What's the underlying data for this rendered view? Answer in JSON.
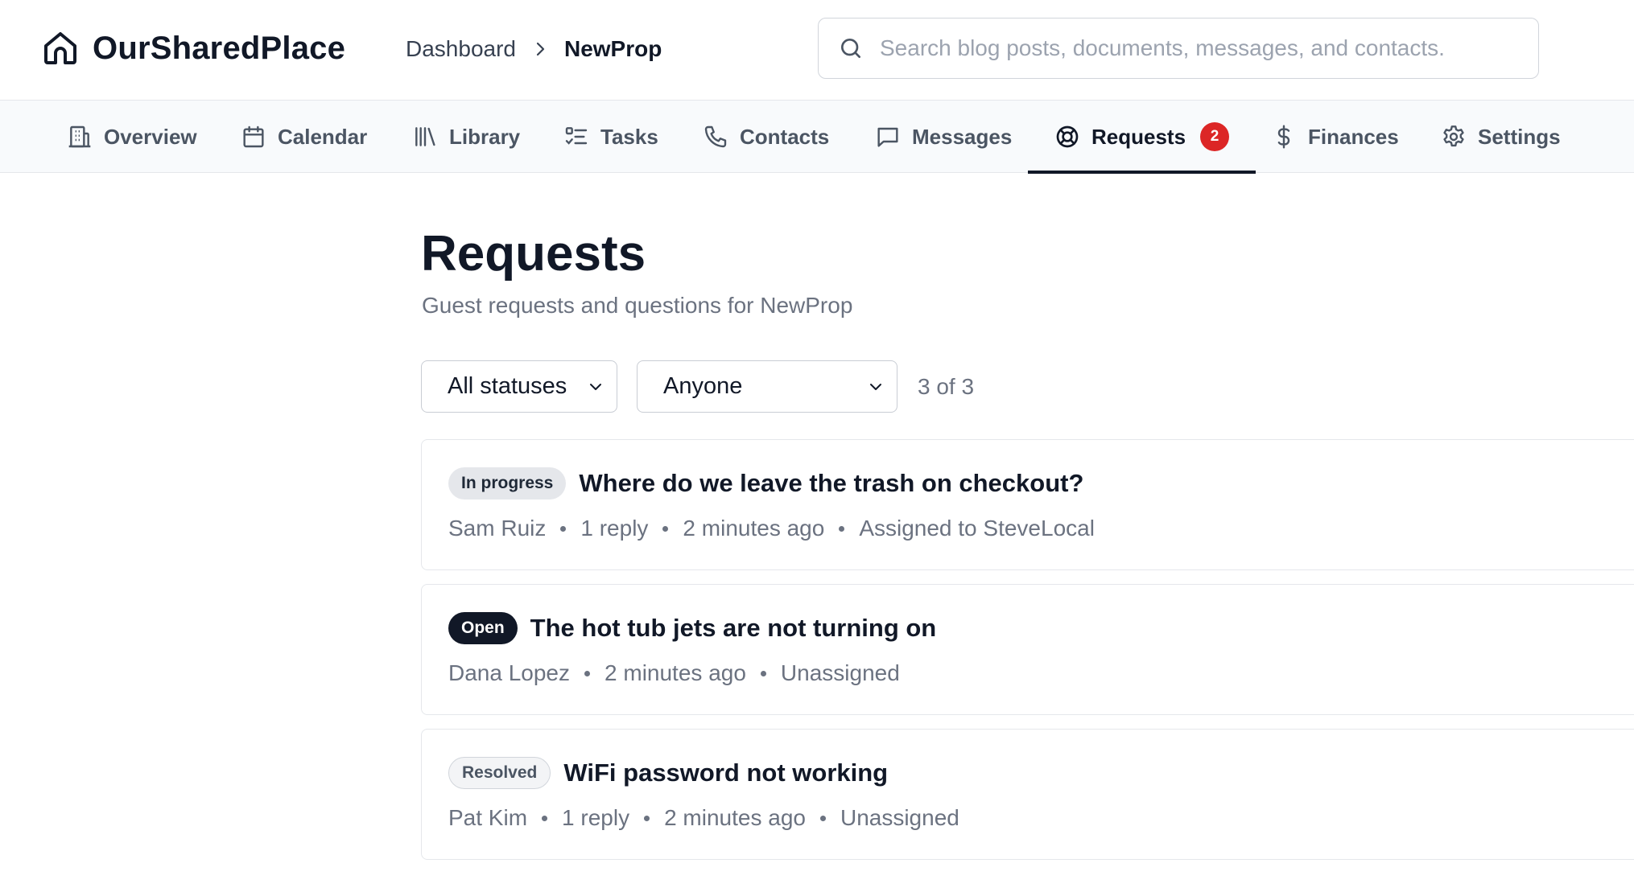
{
  "header": {
    "app_name": "OurSharedPlace",
    "breadcrumb": {
      "root": "Dashboard",
      "current": "NewProp"
    },
    "search": {
      "placeholder": "Search blog posts, documents, messages, and contacts.",
      "value": ""
    }
  },
  "tabs": [
    {
      "label": "Overview",
      "icon": "building-icon"
    },
    {
      "label": "Calendar",
      "icon": "calendar-icon"
    },
    {
      "label": "Library",
      "icon": "library-icon"
    },
    {
      "label": "Tasks",
      "icon": "tasks-icon"
    },
    {
      "label": "Contacts",
      "icon": "phone-icon"
    },
    {
      "label": "Messages",
      "icon": "message-icon"
    },
    {
      "label": "Requests",
      "icon": "lifebuoy-icon",
      "badge": "2",
      "active": true
    },
    {
      "label": "Finances",
      "icon": "dollar-icon"
    },
    {
      "label": "Settings",
      "icon": "gear-icon"
    }
  ],
  "main": {
    "title": "Requests",
    "subtitle": "Guest requests and questions for NewProp",
    "filters": {
      "status": {
        "selected": "All statuses"
      },
      "assignee": {
        "selected": "Anyone"
      },
      "count": "3 of 3"
    },
    "requests": [
      {
        "status": "In progress",
        "title": "Where do we leave the trash on checkout?",
        "author": "Sam Ruiz",
        "replies": "1 reply",
        "time": "2 minutes ago",
        "assignment": "Assigned to SteveLocal"
      },
      {
        "status": "Open",
        "title": "The hot tub jets are not turning on",
        "author": "Dana Lopez",
        "time": "2 minutes ago",
        "assignment": "Unassigned"
      },
      {
        "status": "Resolved",
        "title": "WiFi password not working",
        "author": "Pat Kim",
        "replies": "1 reply",
        "time": "2 minutes ago",
        "assignment": "Unassigned"
      }
    ]
  },
  "colors": {
    "text_primary": "#111827",
    "text_muted": "#6b7280",
    "badge_red": "#dc2626",
    "tab_bar_bg": "#f8fafc",
    "border": "#e5e7eb"
  }
}
